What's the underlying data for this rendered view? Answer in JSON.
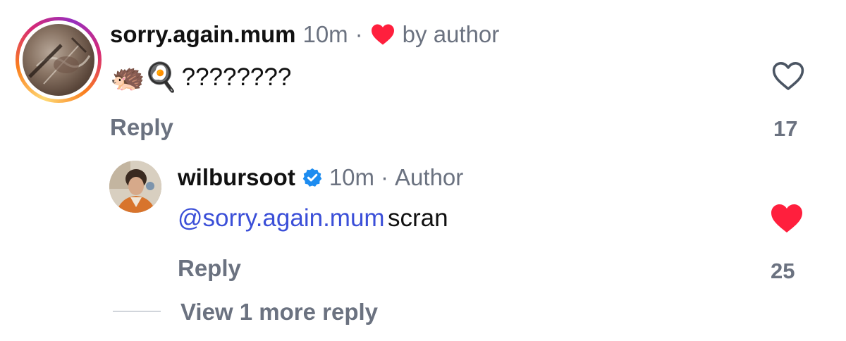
{
  "comment": {
    "username": "sorry.again.mum",
    "time": "10m",
    "separator": "·",
    "liked_by_label": "by author",
    "emoji_text": "🦔🍳",
    "text": "????????",
    "reply_label": "Reply",
    "like_count": "17",
    "liked": false
  },
  "reply": {
    "username": "wilbursoot",
    "verified": true,
    "time": "10m",
    "separator": "·",
    "badge": "Author",
    "mention": "@sorry.again.mum",
    "text": "scran",
    "reply_label": "Reply",
    "like_count": "25",
    "liked": true
  },
  "thread": {
    "view_more_label": "View 1 more reply"
  },
  "colors": {
    "heart_red": "#ff1f3d",
    "muted_text": "#6b7280",
    "mention_blue": "#3b4fd8",
    "verified_blue": "#1d8cf0"
  },
  "icons": {
    "liked_by_author": "heart-filled-icon",
    "like_main": "heart-outline-icon",
    "like_reply": "heart-filled-icon",
    "verified": "verified-badge-icon"
  }
}
